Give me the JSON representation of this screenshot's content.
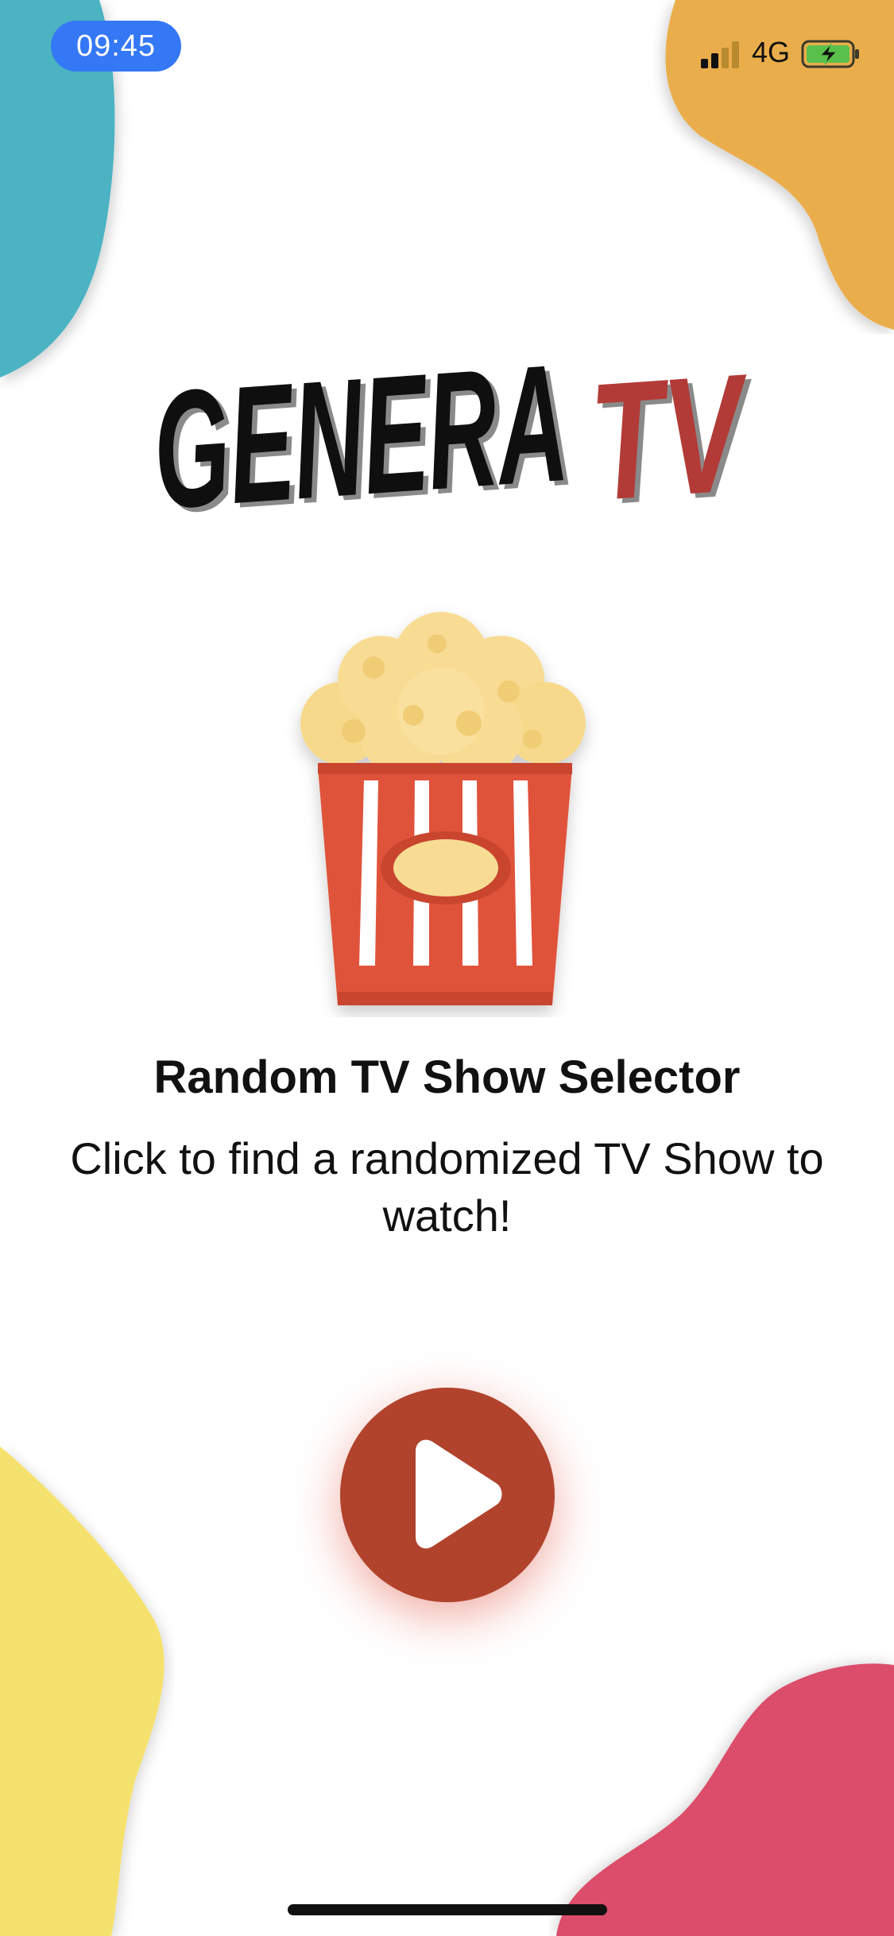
{
  "status_bar": {
    "time": "09:45",
    "network": "4G",
    "signal_icon": "cellular-signal-icon",
    "battery_icon": "battery-charging-icon"
  },
  "logo": {
    "part1": "GENERA",
    "part2": "TV",
    "color_primary": "#0f0f0f",
    "color_accent": "#b23b37"
  },
  "hero_icon": "popcorn-icon",
  "main": {
    "title": "Random TV Show Selector",
    "subtitle": "Click to find a randomized TV Show to watch!"
  },
  "play_button": {
    "icon": "play-icon",
    "color": "#b1432c"
  },
  "colors": {
    "blob_teal": "#4bb3c2",
    "blob_orange": "#eaad4b",
    "blob_yellow": "#f5e16d",
    "blob_pink": "#db4d6b",
    "popcorn_red": "#e0533b",
    "popcorn_kernel": "#f8dc93"
  }
}
